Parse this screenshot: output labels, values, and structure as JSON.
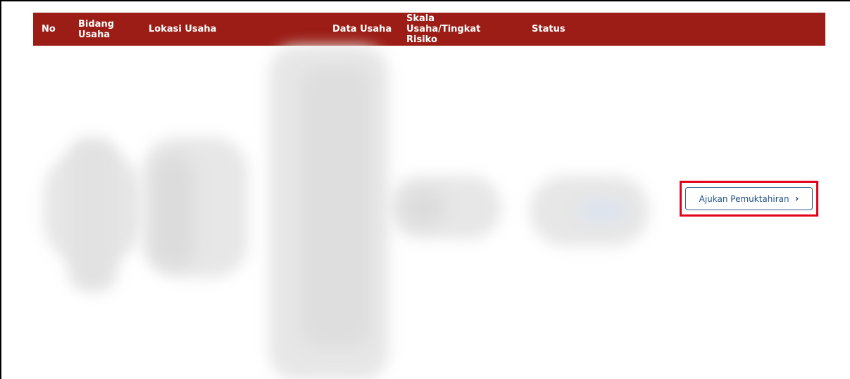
{
  "table": {
    "headers": {
      "no": "No",
      "bidang_usaha": "Bidang Usaha",
      "lokasi_usaha": "Lokasi Usaha",
      "data_usaha": "Data Usaha",
      "skala_usaha": "Skala Usaha/Tingkat Risiko",
      "status": "Status"
    }
  },
  "row": {
    "action_label": "Ajukan Pemuktahiran",
    "action_icon": "chevron-right-icon"
  },
  "colors": {
    "header_bg": "#9b1d15",
    "header_text": "#ffffff",
    "highlight_border": "#e3001b",
    "button_border": "#2b5a88",
    "button_text": "#1f4f82"
  }
}
